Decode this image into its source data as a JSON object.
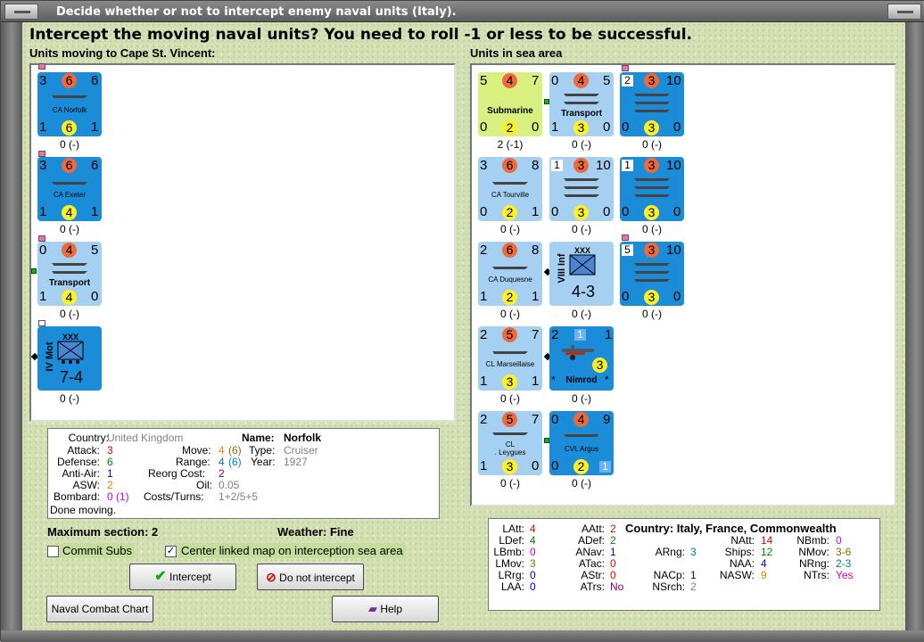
{
  "window": {
    "title": "Decide whether or not to intercept enemy naval units (Italy)."
  },
  "headline": "Intercept the moving naval units?  You need to roll -1 or less to be successful.",
  "left_panel": {
    "label": "Units moving to Cape St. Vincent:",
    "units": [
      {
        "name": "CA Norfolk",
        "tl": "3",
        "att": "6",
        "tr": "6",
        "bl": "1",
        "def": "6",
        "br": "1",
        "caption": "0 (-)"
      },
      {
        "name": "CA Exeter",
        "tl": "3",
        "att": "6",
        "tr": "6",
        "bl": "1",
        "def": "4",
        "br": "1",
        "caption": "0 (-)"
      },
      {
        "name": "Transport",
        "tl": "0",
        "att": "4",
        "tr": "5",
        "bl": "1",
        "def": "4",
        "br": "0",
        "caption": "0 (-)"
      },
      {
        "name": "IV Mot",
        "size": "XXX",
        "strength": "7-4",
        "caption": "0 (-)"
      }
    ]
  },
  "right_panel": {
    "label": "Units in sea area",
    "units": [
      {
        "name": "Submarine",
        "tl": "5",
        "att": "4",
        "tr": "7",
        "bl": "0",
        "def": "2",
        "br": "0",
        "caption": "2 (-1)"
      },
      {
        "name": "Transport",
        "tl": "0",
        "att": "4",
        "tr": "5",
        "bl": "1",
        "def": "3",
        "br": "0",
        "caption": "0 (-)"
      },
      {
        "name": "",
        "wn": "2",
        "att": "3",
        "tr": "10",
        "bl": "0",
        "def": "3",
        "br": "0",
        "caption": "0 (-)"
      },
      {
        "name": "CA Tourville",
        "tl": "3",
        "att": "6",
        "tr": "8",
        "bl": "0",
        "def": "2",
        "br": "1",
        "caption": "0 (-)"
      },
      {
        "name": "",
        "wn": "1",
        "att": "3",
        "tr": "10",
        "bl": "0",
        "def": "3",
        "br": "0",
        "caption": "0 (-)"
      },
      {
        "name": "",
        "wn": "1",
        "att": "3",
        "tr": "10",
        "bl": "0",
        "def": "3",
        "br": "0",
        "caption": "0 (-)"
      },
      {
        "name": "CA Duquesne",
        "tl": "2",
        "att": "6",
        "tr": "8",
        "bl": "1",
        "def": "2",
        "br": "1",
        "caption": "0 (-)"
      },
      {
        "name": "VIII Inf",
        "size": "XXX",
        "strength": "4-3",
        "caption": "0 (-)"
      },
      {
        "name": "",
        "wn": "5",
        "att": "3",
        "tr": "10",
        "bl": "0",
        "def": "3",
        "br": "0",
        "caption": "0 (-)"
      },
      {
        "name": "CL Marseillaise",
        "tl": "2",
        "att": "5",
        "tr": "7",
        "bl": "1",
        "def": "3",
        "br": "1",
        "caption": "0 (-)"
      },
      {
        "name": "Nimrod",
        "tl": "2",
        "top": "1",
        "tr": "1",
        "def": "3",
        "bl": "*",
        "br": "*",
        "caption": "0 (-)"
      },
      {
        "name": "CL",
        "name2": ". Leygues",
        "tl": "2",
        "att": "5",
        "tr": "7",
        "bl": "1",
        "def": "3",
        "br": "0",
        "caption": "0 (-)"
      },
      {
        "name": "CVL Argus",
        "tl": "0",
        "att": "4",
        "tr": "9",
        "bl": "0",
        "def": "2",
        "br": "1",
        "caption": "0 (-)"
      }
    ]
  },
  "info": {
    "country_label": "Country:",
    "country": "United Kingdom",
    "attack_label": "Attack:",
    "attack": "3",
    "defense_label": "Defense:",
    "defense": "6",
    "antiair_label": "Anti-Air:",
    "antiair": "1",
    "asw_label": "ASW:",
    "asw": "2",
    "bombard_label": "Bombard:",
    "bombard": "0 (1)",
    "name_label": "Name:",
    "name": "Norfolk",
    "move_label": "Move:",
    "move_a": "4",
    "move_b": "(6)",
    "type_label": "Type:",
    "type": "Cruiser",
    "range_label": "Range:",
    "range_a": "4",
    "range_b": "(6)",
    "year_label": "Year:",
    "year": "1927",
    "reorg_label": "Reorg Cost:",
    "reorg": "2",
    "oil_label": "Oil:",
    "oil": "0.05",
    "costs_label": "Costs/Turns:",
    "costs": "1+2/5+5",
    "status": "Done moving."
  },
  "max_section": "Maximum section: 2",
  "weather": "Weather:  Fine",
  "commit_subs": "Commit Subs",
  "center_map": "Center linked map on interception sea area",
  "buttons": {
    "intercept": "Intercept",
    "do_not": "Do not intercept",
    "chart": "Naval Combat Chart",
    "help": "Help"
  },
  "stats": {
    "country": "Country: Italy, France, Commonwealth",
    "latt": "LAtt:",
    "latt_v": "4",
    "ldef": "LDef:",
    "ldef_v": "4",
    "lbmb": "LBmb:",
    "lbmb_v": "0",
    "lmov": "LMov:",
    "lmov_v": "3",
    "lrg": "LRrg:",
    "lrg_v": "0",
    "laa": "LAA:",
    "laa_v": "0",
    "aatt": "AAtt:",
    "aatt_v": "2",
    "adef": "ADef:",
    "adef_v": "2",
    "anav": "ANav:",
    "anav_v": "1",
    "atac": "ATac:",
    "atac_v": "0",
    "astr": "AStr:",
    "astr_v": "0",
    "atrs": "ATrs:",
    "atrs_v": "No",
    "arng": "ARng:",
    "arng_v": "3",
    "nacp": "NACp:",
    "nacp_v": "1",
    "nsrch": "NSrch:",
    "nsrch_v": "2",
    "natt": "NAtt:",
    "natt_v": "14",
    "ships": "Ships:",
    "ships_v": "12",
    "naa": "NAA:",
    "naa_v": "4",
    "nasw": "NASW:",
    "nasw_v": "9",
    "nbmb": "NBmb:",
    "nbmb_v": "0",
    "nmov": "NMov:",
    "nmov_v": "3-6",
    "nrng": "NRng:",
    "nrng_v": "2-3",
    "ntrs": "NTrs:",
    "ntrs_v": "Yes"
  },
  "colors": {
    "red": "#e00000",
    "green": "#008000",
    "blue": "#0000e0",
    "orange": "#e08000",
    "magenta": "#d000d0",
    "olive": "#807000",
    "teal": "#008080",
    "purple": "#800080",
    "gray": "#808080"
  }
}
